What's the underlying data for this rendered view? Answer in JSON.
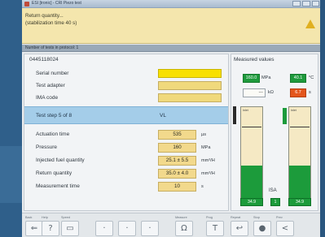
{
  "window": {
    "title": "ESI [tronic] - CRI Piezo test"
  },
  "prompt": {
    "line1": "Return quantity...",
    "line2": "(stabilization time 40 s)"
  },
  "infobar": {
    "text": "Number of tests in protocol: 1"
  },
  "left_panel": {
    "serial_value": "0445118024",
    "fields": [
      {
        "label": "Serial number"
      },
      {
        "label": "Test adapter"
      },
      {
        "label": "IMA code"
      }
    ],
    "test_step": {
      "label": "Test step 5 of 8",
      "value": "VL"
    },
    "measurements": [
      {
        "label": "Actuation time",
        "value": "535",
        "unit": "µs"
      },
      {
        "label": "Pressure",
        "value": "160",
        "unit": "MPa"
      },
      {
        "label": "Injected fuel quantity",
        "value": "25.1 ± 5.5",
        "unit": "mm³/H"
      },
      {
        "label": "Return quantity",
        "value": "35.0 ± 4.0",
        "unit": "mm³/H"
      },
      {
        "label": "Measurement time",
        "value": "10",
        "unit": "s"
      }
    ]
  },
  "right_panel": {
    "title": "Measured values",
    "pressure": {
      "value": "160.0",
      "unit": "MPa"
    },
    "temperature": {
      "value": "40.1",
      "unit": "°C"
    },
    "resistance": {
      "value": "---",
      "unit": "kΩ"
    },
    "status": {
      "value": "6.7",
      "unit": "s"
    },
    "left_gauge": {
      "label": "Inlet",
      "fill_fraction": 0.38,
      "readout": "34.9"
    },
    "right_gauge": {
      "label": "Inlet",
      "fill_fraction": 0.38,
      "readout": "34.9"
    },
    "center_label": "ISA",
    "center_value": "1"
  },
  "toolbar": {
    "items": [
      {
        "caption": "Back",
        "icon": "back-icon",
        "glyph": "⇐"
      },
      {
        "caption": "Help",
        "icon": "help-icon",
        "glyph": "?"
      },
      {
        "caption": "Speed",
        "icon": "keyboard-icon",
        "glyph": "▭"
      },
      {
        "caption": "",
        "icon": "empty-slot-icon",
        "glyph": "·"
      },
      {
        "caption": "",
        "icon": "empty-slot-icon",
        "glyph": "·"
      },
      {
        "caption": "",
        "icon": "empty-slot-icon",
        "glyph": "·"
      },
      {
        "caption": "Measure",
        "icon": "resistance-icon",
        "glyph": "Ω"
      },
      {
        "caption": "Prog",
        "icon": "program-icon",
        "glyph": "T"
      },
      {
        "caption": "Repeat",
        "icon": "repeat-icon",
        "glyph": "↩"
      },
      {
        "caption": "Stop",
        "icon": "stop-icon",
        "glyph": "●"
      },
      {
        "caption": "Prev",
        "icon": "previous-icon",
        "glyph": "<"
      }
    ]
  }
}
